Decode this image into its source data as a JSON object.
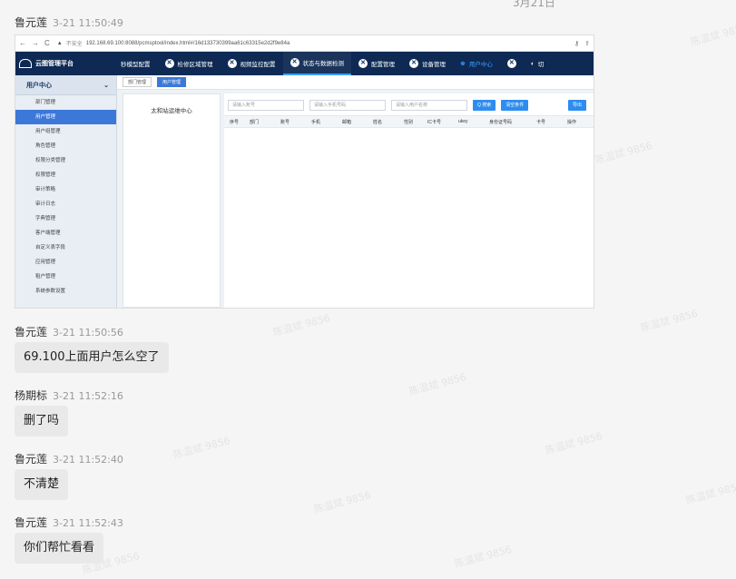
{
  "top_date": "3月21日",
  "messages": [
    {
      "sender": "鲁元莲",
      "time": "3-21 11:50:49",
      "type": "image"
    },
    {
      "sender": "鲁元莲",
      "time": "3-21 11:50:56",
      "text": "69.100上面用户怎么空了"
    },
    {
      "sender": "杨期标",
      "time": "3-21 11:52:16",
      "text": "删了吗"
    },
    {
      "sender": "鲁元莲",
      "time": "3-21 11:52:40",
      "text": "不清楚"
    },
    {
      "sender": "鲁元莲",
      "time": "3-21 11:52:43",
      "text": "你们帮忙看看"
    }
  ],
  "watermark_text": "陈温斌 9856",
  "screenshot": {
    "browser": {
      "secure_label": "不安全",
      "url": "192.168.69.100:8088/pcmsptool/index.html#/16d133730399aa61c63315e2d2f9e84a"
    },
    "app": {
      "title": "云图管理平台",
      "nav": [
        "秒模型配置",
        "检修区域管理",
        "视频监控配置",
        "状态与数据检测",
        "配置管理",
        "设备管理",
        "用户中心",
        "切"
      ]
    },
    "sidebar": {
      "title": "用户中心",
      "items": [
        "部门管理",
        "用户管理",
        "用户组管理",
        "角色管理",
        "权限分类管理",
        "权限管理",
        "审计策略",
        "审计日志",
        "字典管理",
        "客户端管理",
        "自定义表字段",
        "应用管理",
        "租户管理",
        "系统参数设置"
      ],
      "active_index": 1
    },
    "crumbs": [
      "部门管理",
      "用户管理"
    ],
    "tree_root": "太和站运维中心",
    "filters": {
      "account_placeholder": "请输入账号",
      "phone_placeholder": "请输入手机号码",
      "username_placeholder": "请输入用户名称",
      "search": "Q 搜索",
      "clear": "清空条件",
      "export": "导出"
    },
    "columns": [
      "序号",
      "部门",
      "账号",
      "手机",
      "邮箱",
      "姓名",
      "性别",
      "IC卡号",
      "ukey",
      "身份证号码",
      "卡号",
      "操作"
    ]
  },
  "colors": {
    "header_bg": "#0e2a54",
    "accent": "#3c78d8",
    "button": "#2d8cf0",
    "bubble": "#e9e9e9"
  }
}
